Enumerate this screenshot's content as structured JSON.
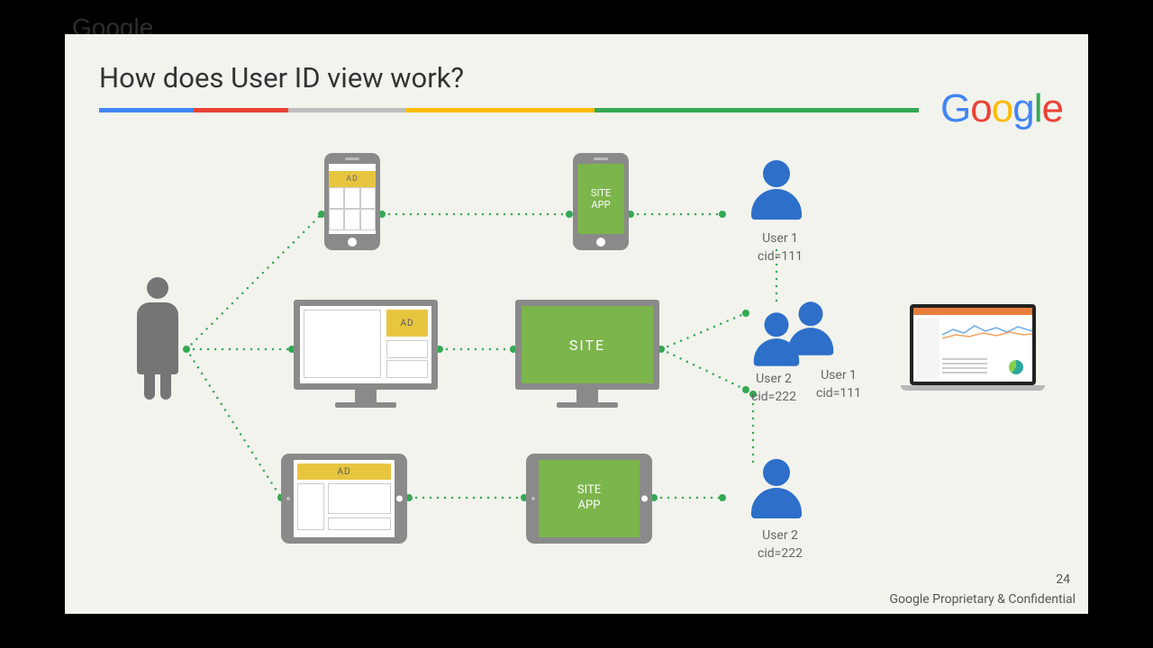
{
  "watermark": "Google",
  "title": "How does User ID view work?",
  "logo_letters": [
    "G",
    "o",
    "o",
    "g",
    "l",
    "e"
  ],
  "labels": {
    "ad": "AD",
    "site": "SITE",
    "site_app": "SITE\nAPP"
  },
  "users": {
    "u1": {
      "name": "User 1",
      "cid": "cid=111"
    },
    "u2a": {
      "name": "User 2",
      "cid": "cid=222"
    },
    "u1a": {
      "name": "User 1",
      "cid": "cid=111"
    },
    "u2": {
      "name": "User 2",
      "cid": "cid=222"
    }
  },
  "page_number": "24",
  "confidential": "Google Proprietary & Confidential"
}
